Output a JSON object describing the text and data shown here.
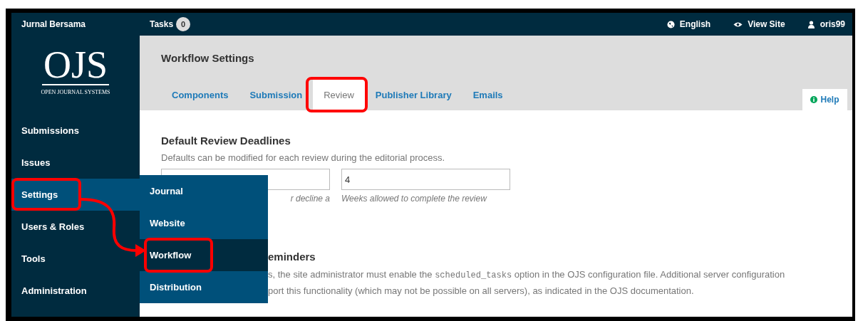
{
  "top_bar": {
    "site_name": "Jurnal Bersama",
    "tasks": {
      "label": "Tasks",
      "count": "0"
    },
    "language": "English",
    "view_site": "View Site",
    "user": "oris99"
  },
  "logo": {
    "title": "OJS",
    "subtitle": "OPEN JOURNAL SYSTEMS"
  },
  "sidebar": {
    "items": [
      {
        "label": "Submissions",
        "selected": false
      },
      {
        "label": "Issues",
        "selected": false
      },
      {
        "label": "Settings",
        "selected": true
      },
      {
        "label": "Users & Roles",
        "selected": false
      },
      {
        "label": "Tools",
        "selected": false
      },
      {
        "label": "Administration",
        "selected": false
      }
    ]
  },
  "settings_menu": {
    "items": [
      {
        "label": "Journal",
        "selected": false
      },
      {
        "label": "Website",
        "selected": false
      },
      {
        "label": "Workflow",
        "selected": true
      },
      {
        "label": "Distribution",
        "selected": false
      }
    ]
  },
  "page": {
    "title": "Workflow Settings",
    "tabs": [
      {
        "label": "Components",
        "selected": false
      },
      {
        "label": "Submission",
        "selected": false
      },
      {
        "label": "Review",
        "selected": true
      },
      {
        "label": "Publisher Library",
        "selected": false
      },
      {
        "label": "Emails",
        "selected": false
      }
    ],
    "help": "Help"
  },
  "deadlines": {
    "heading": "Default Review Deadlines",
    "description": "Defaults can be modified for each review during the editorial process.",
    "fields": [
      {
        "helper": "r decline a"
      },
      {
        "value": "4",
        "helper": "Weeks allowed to complete the review"
      }
    ]
  },
  "reminders": {
    "heading": "eminders",
    "lines": [
      [
        {
          "kind": "text",
          "text": "s, the site administrator must enable the "
        },
        {
          "kind": "code",
          "text": "scheduled_tasks"
        },
        {
          "kind": "text",
          "text": " option in the OJS configuration file. Additional server configuration"
        }
      ],
      [
        {
          "kind": "text",
          "text": "port this functionality (which may not be possible on all servers), as indicated in the OJS documentation."
        }
      ]
    ]
  }
}
